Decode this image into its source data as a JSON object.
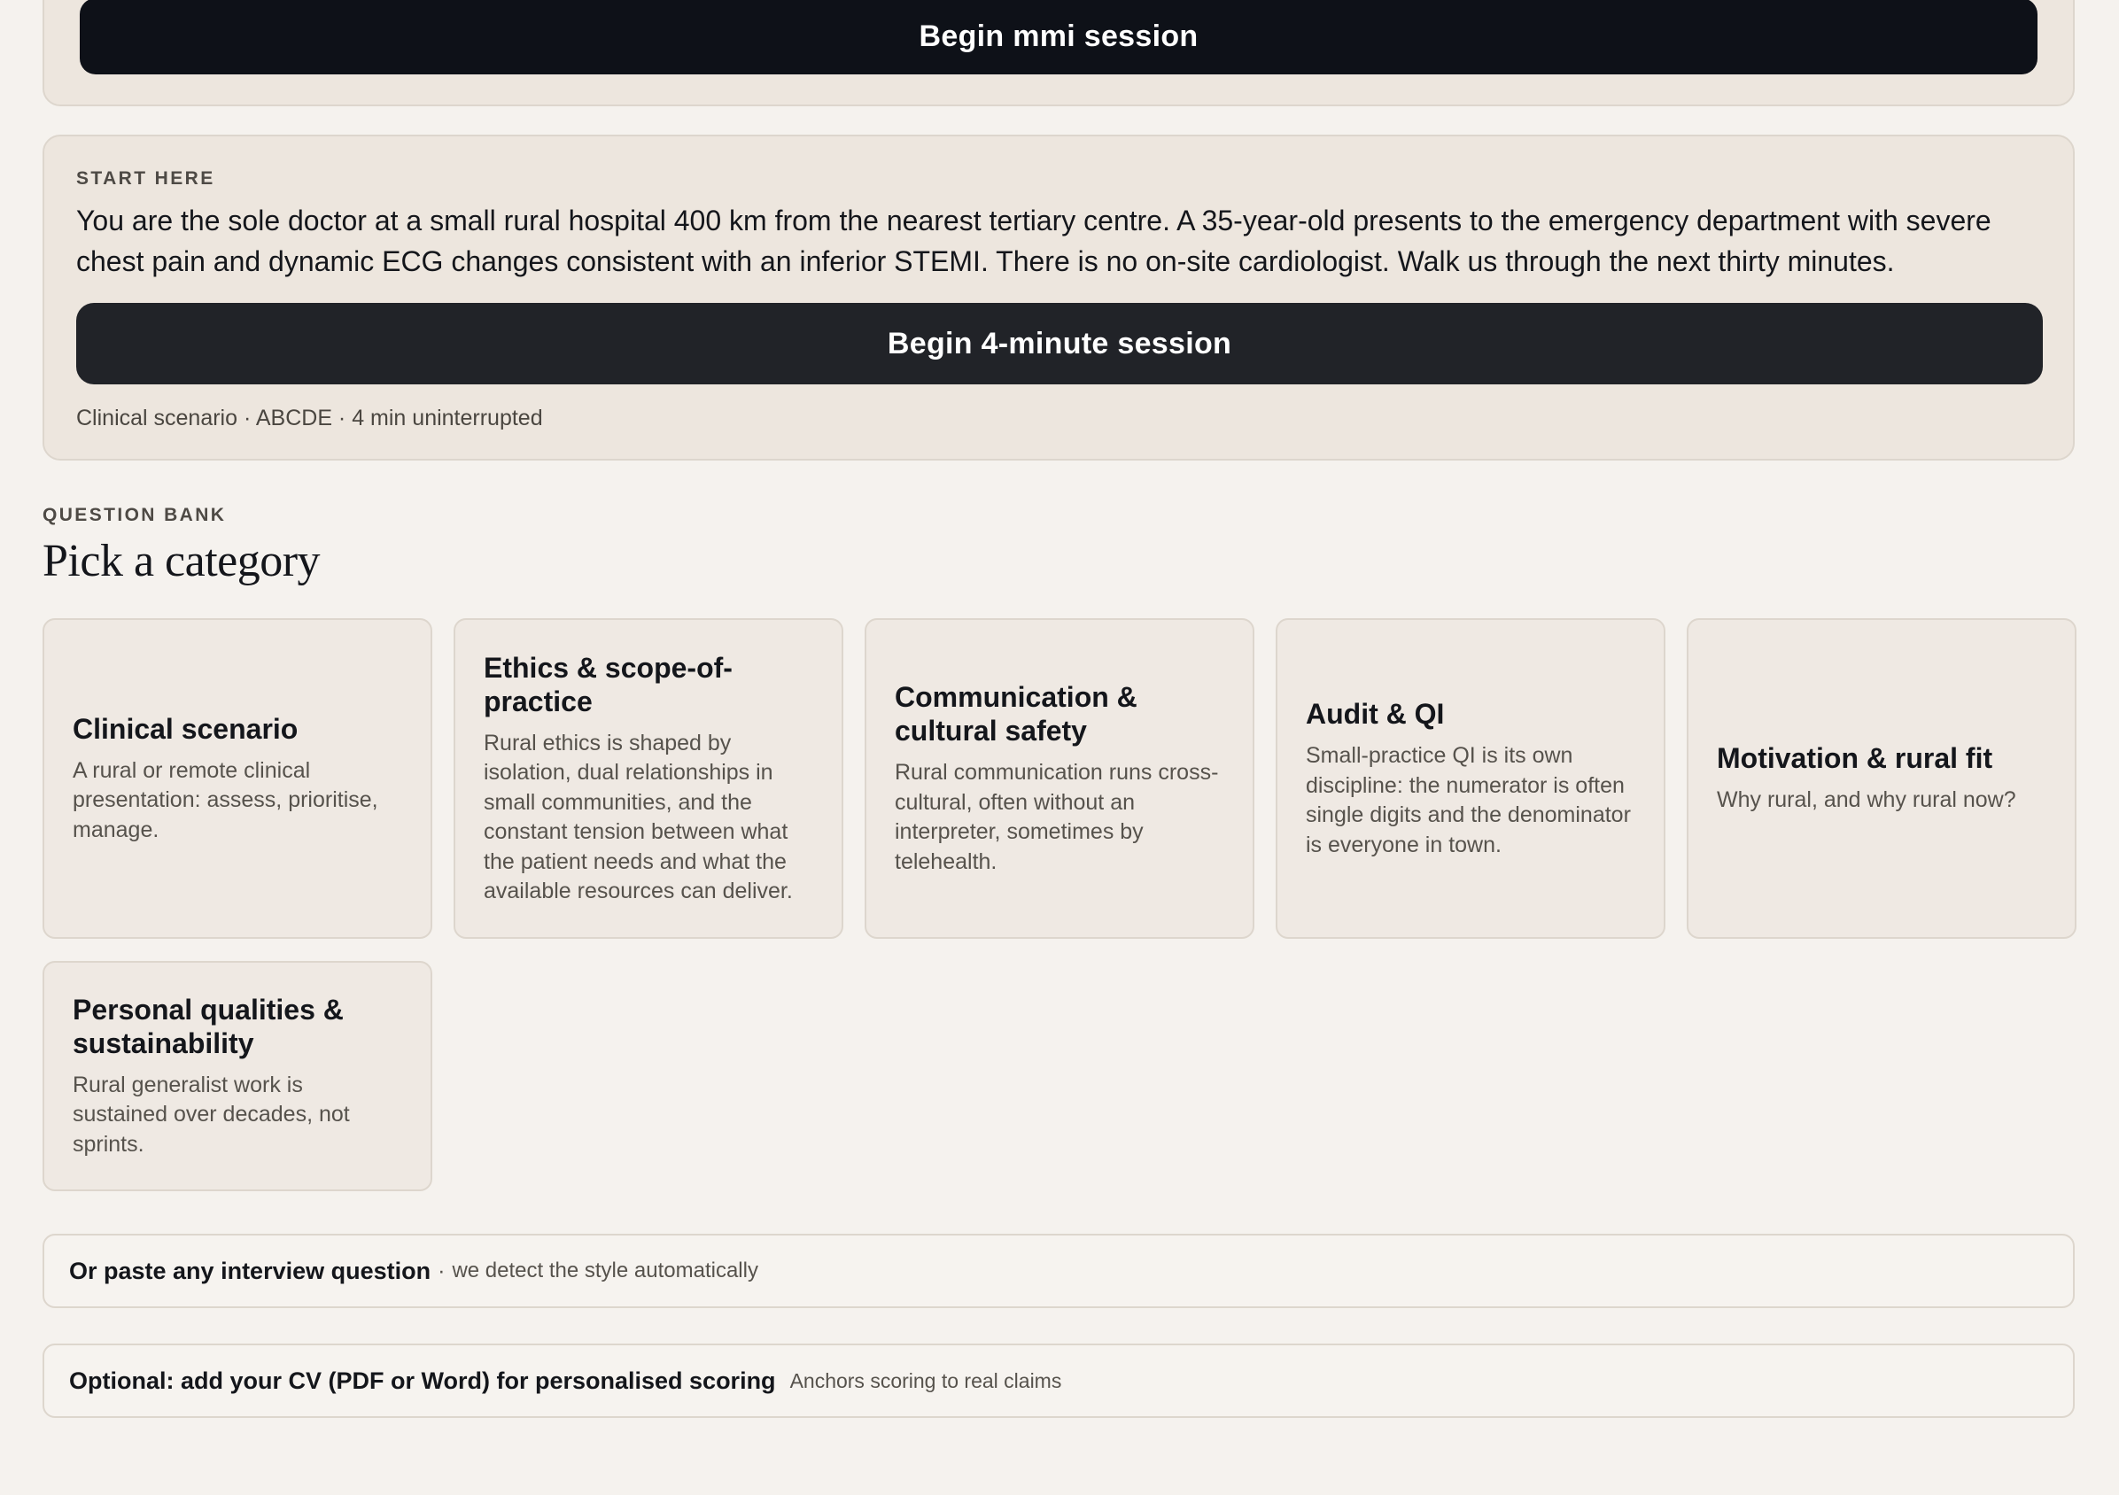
{
  "top_panel": {
    "button_label": "Begin mmi session"
  },
  "start_here": {
    "eyebrow": "START HERE",
    "prompt": "You are the sole doctor at a small rural hospital 400 km from the nearest tertiary centre. A 35-year-old presents to the emergency department with severe chest pain and dynamic ECG changes consistent with an inferior STEMI. There is no on-site cardiologist. Walk us through the next thirty minutes.",
    "button_label": "Begin 4-minute session",
    "meta": "Clinical scenario · ABCDE · 4 min uninterrupted"
  },
  "question_bank": {
    "eyebrow": "QUESTION BANK",
    "title": "Pick a category",
    "categories": [
      {
        "title": "Clinical scenario",
        "description": "A rural or remote clinical presentation: assess, prioritise, manage."
      },
      {
        "title": "Ethics & scope-of-practice",
        "description": "Rural ethics is shaped by isolation, dual relationships in small communities, and the constant tension between what the patient needs and what the available resources can deliver."
      },
      {
        "title": "Communication & cultural safety",
        "description": "Rural communication runs cross-cultural, often without an interpreter, sometimes by telehealth."
      },
      {
        "title": "Audit & QI",
        "description": "Small-practice QI is its own discipline: the numerator is often single digits and the denominator is everyone in town."
      },
      {
        "title": "Motivation & rural fit",
        "description": "Why rural, and why rural now?"
      },
      {
        "title": "Personal qualities & sustainability",
        "description": "Rural generalist work is sustained over decades, not sprints."
      }
    ]
  },
  "paste_bar": {
    "label": "Or paste any interview question",
    "separator": "·",
    "note": "we detect the style automatically"
  },
  "cv_bar": {
    "label": "Optional: add your CV (PDF or Word) for personalised scoring",
    "note": "Anchors scoring to real claims"
  }
}
